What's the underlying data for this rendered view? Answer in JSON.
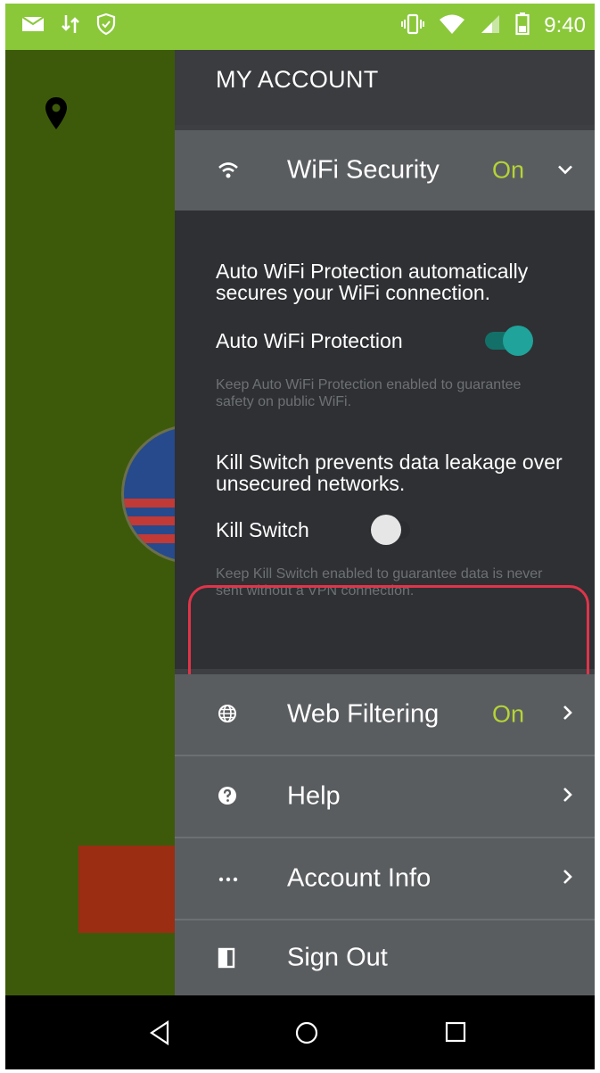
{
  "status_bar": {
    "time": "9:40",
    "left_icons": [
      "mail-icon",
      "transfer-icon",
      "shield-check-icon"
    ],
    "right_icons": [
      "vibrate-icon",
      "wifi-icon",
      "signal-icon",
      "battery-icon"
    ],
    "color": "#8ac83a"
  },
  "drawer": {
    "title": "MY ACCOUNT",
    "wifi_security": {
      "label": "WiFi Security",
      "status": "On",
      "icon": "wifi-icon",
      "expanded": true
    },
    "wifi_panel": {
      "auto_desc": "Auto WiFi Protection automatically secures your WiFi connection.",
      "auto_label": "Auto WiFi Protection",
      "auto_enabled": true,
      "auto_help": "Keep Auto WiFi Protection enabled to guarantee safety on public WiFi.",
      "kill_desc": "Kill Switch prevents data leakage over unsecured networks.",
      "kill_label": "Kill Switch",
      "kill_enabled": false,
      "kill_help": "Keep Kill Switch enabled to guarantee data is never sent without a VPN connection."
    },
    "web_filtering": {
      "label": "Web Filtering",
      "status": "On",
      "icon": "globe-icon"
    },
    "help": {
      "label": "Help",
      "icon": "help-icon"
    },
    "account_info": {
      "label": "Account Info",
      "icon": "more-dots-icon"
    },
    "sign_out": {
      "label": "Sign Out",
      "icon": "sign-out-icon"
    }
  },
  "colors": {
    "accent_on": "#b6d336",
    "toggle_on": "#1fa39a",
    "highlight": "#e0344a"
  },
  "nav_bar": {
    "buttons": [
      "back-icon",
      "home-icon",
      "recents-icon"
    ]
  }
}
